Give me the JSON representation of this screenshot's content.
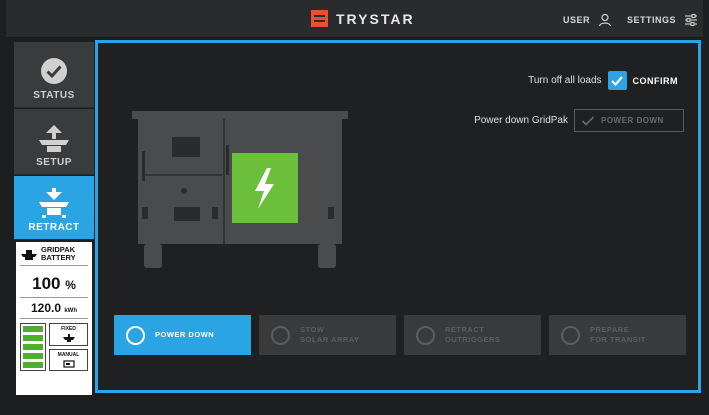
{
  "header": {
    "brand": "TRYSTAR",
    "user_label": "USER",
    "settings_label": "SETTINGS"
  },
  "sidebar": {
    "items": [
      {
        "label": "STATUS",
        "icon": "check-circle-icon",
        "active": false
      },
      {
        "label": "SETUP",
        "icon": "solar-array-icon",
        "active": false
      },
      {
        "label": "RETRACT",
        "icon": "retract-array-icon",
        "active": true
      }
    ],
    "battery": {
      "title_line1": "GRIDPAK",
      "title_line2": "BATTERY",
      "percent_value": "100",
      "percent_unit": "%",
      "energy_value": "120.0",
      "energy_unit": "kWh",
      "mode_fixed": "FIXED",
      "mode_manual": "MANUAL",
      "charge_level": 1.0
    }
  },
  "controls": {
    "turn_off_label": "Turn off all loads",
    "confirm_label": "CONFIRM",
    "confirm_checked": true,
    "power_down_label": "Power down GridPak",
    "power_down_button": "POWER DOWN",
    "power_down_enabled": false
  },
  "steps": [
    {
      "label": "POWER DOWN",
      "active": true
    },
    {
      "label": "STOW\nSOLAR ARRAY",
      "active": false
    },
    {
      "label": "RETRACT\nOUTRIGGERS",
      "active": false
    },
    {
      "label": "PREPARE\nFOR TRANSIT",
      "active": false
    }
  ],
  "colors": {
    "accent": "#2aa4e2",
    "brand": "#e2542b",
    "battery_green": "#4caf2e",
    "lightning_panel": "#6abf3b"
  }
}
